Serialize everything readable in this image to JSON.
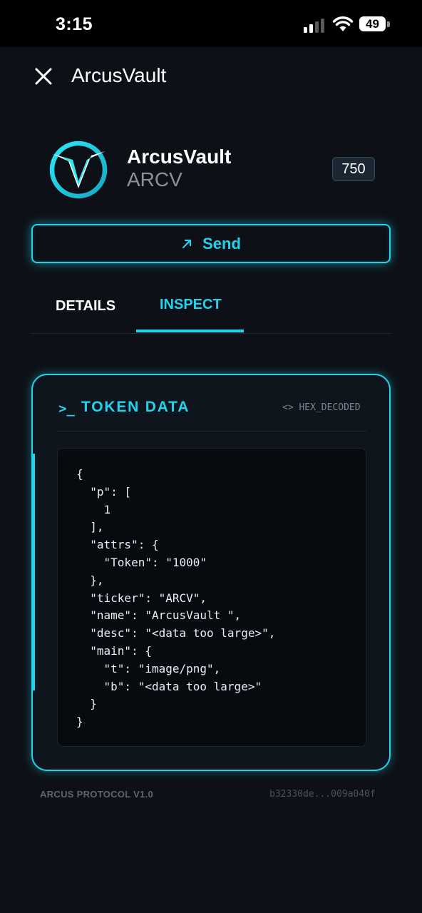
{
  "status_bar": {
    "time": "3:15",
    "battery": "49"
  },
  "header": {
    "title": "ArcusVault"
  },
  "token": {
    "name": "ArcusVault",
    "ticker": "ARCV",
    "amount": "750"
  },
  "actions": {
    "send_label": "Send"
  },
  "tabs": [
    {
      "label": "DETAILS",
      "active": false
    },
    {
      "label": "INSPECT",
      "active": true
    }
  ],
  "panel": {
    "title": "TOKEN DATA",
    "format": "<> HEX_DECODED",
    "code": "{\n  \"p\": [\n    1\n  ],\n  \"attrs\": {\n    \"Token\": \"1000\"\n  },\n  \"ticker\": \"ARCV\",\n  \"name\": \"ArcusVault \",\n  \"desc\": \"<data too large>\",\n  \"main\": {\n    \"t\": \"image/png\",\n    \"b\": \"<data too large>\"\n  }\n}"
  },
  "footer": {
    "protocol": "ARCUS PROTOCOL V1.0",
    "hash": "b32330de...009a040f"
  },
  "colors": {
    "accent": "#22d3ee",
    "background": "#0d1117"
  },
  "icons": {
    "close": "close-icon",
    "send": "arrow-up-right-icon",
    "prompt": "terminal-prompt-icon",
    "logo": "arcus-logo"
  }
}
